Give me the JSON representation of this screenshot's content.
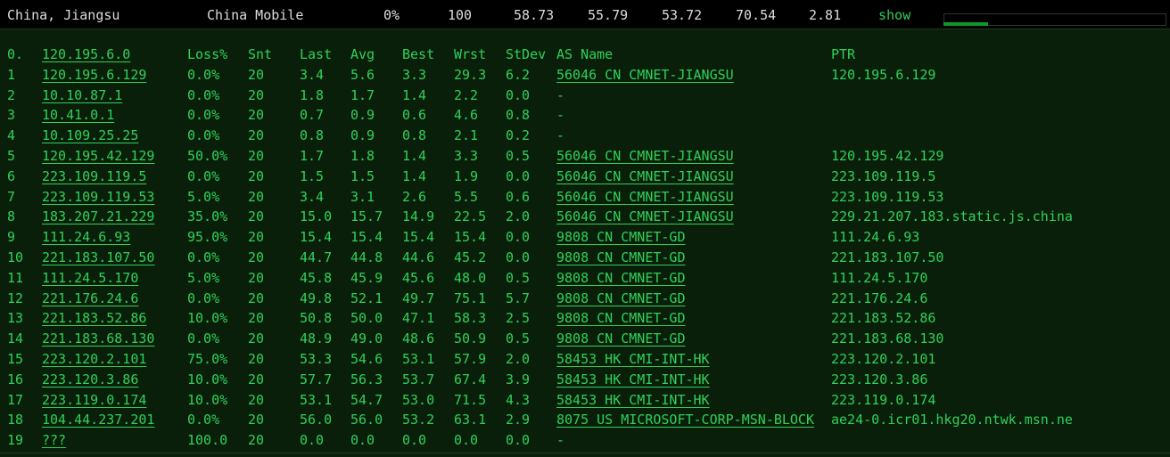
{
  "summary": {
    "location": "China, Jiangsu",
    "isp": "China Mobile",
    "loss": "0%",
    "sent": "100",
    "last": "58.73",
    "avg": "55.79",
    "best": "53.72",
    "worst": "70.54",
    "stdev": "2.81",
    "show_label": "show",
    "progress_fraction": 0.2
  },
  "header": {
    "no": "0.",
    "host": "120.195.6.0",
    "loss": "Loss%",
    "snt": "Snt",
    "last": "Last",
    "avg": "Avg",
    "best": "Best",
    "wrst": "Wrst",
    "stdev": "StDev",
    "as": "AS Name",
    "ptr": "PTR"
  },
  "hops": [
    {
      "no": "1",
      "host": "120.195.6.129",
      "loss": "0.0%",
      "snt": "20",
      "last": "3.4",
      "avg": "5.6",
      "best": "3.3",
      "wrst": "29.3",
      "stdev": "6.2",
      "as": "56046 CN CMNET-JIANGSU",
      "ptr": "120.195.6.129"
    },
    {
      "no": "2",
      "host": "10.10.87.1",
      "loss": "0.0%",
      "snt": "20",
      "last": "1.8",
      "avg": "1.7",
      "best": "1.4",
      "wrst": "2.2",
      "stdev": "0.0",
      "as": "-",
      "ptr": ""
    },
    {
      "no": "3",
      "host": "10.41.0.1",
      "loss": "0.0%",
      "snt": "20",
      "last": "0.7",
      "avg": "0.9",
      "best": "0.6",
      "wrst": "4.6",
      "stdev": "0.8",
      "as": "-",
      "ptr": ""
    },
    {
      "no": "4",
      "host": "10.109.25.25",
      "loss": "0.0%",
      "snt": "20",
      "last": "0.8",
      "avg": "0.9",
      "best": "0.8",
      "wrst": "2.1",
      "stdev": "0.2",
      "as": "-",
      "ptr": ""
    },
    {
      "no": "5",
      "host": "120.195.42.129",
      "loss": "50.0%",
      "snt": "20",
      "last": "1.7",
      "avg": "1.8",
      "best": "1.4",
      "wrst": "3.3",
      "stdev": "0.5",
      "as": "56046 CN CMNET-JIANGSU",
      "ptr": "120.195.42.129"
    },
    {
      "no": "6",
      "host": "223.109.119.5",
      "loss": "0.0%",
      "snt": "20",
      "last": "1.5",
      "avg": "1.5",
      "best": "1.4",
      "wrst": "1.9",
      "stdev": "0.0",
      "as": "56046 CN CMNET-JIANGSU",
      "ptr": "223.109.119.5"
    },
    {
      "no": "7",
      "host": "223.109.119.53",
      "loss": "5.0%",
      "snt": "20",
      "last": "3.4",
      "avg": "3.1",
      "best": "2.6",
      "wrst": "5.5",
      "stdev": "0.6",
      "as": "56046 CN CMNET-JIANGSU",
      "ptr": "223.109.119.53"
    },
    {
      "no": "8",
      "host": "183.207.21.229",
      "loss": "35.0%",
      "snt": "20",
      "last": "15.0",
      "avg": "15.7",
      "best": "14.9",
      "wrst": "22.5",
      "stdev": "2.0",
      "as": "56046 CN CMNET-JIANGSU",
      "ptr": "229.21.207.183.static.js.china"
    },
    {
      "no": "9",
      "host": "111.24.6.93",
      "loss": "95.0%",
      "snt": "20",
      "last": "15.4",
      "avg": "15.4",
      "best": "15.4",
      "wrst": "15.4",
      "stdev": "0.0",
      "as": "9808  CN CMNET-GD",
      "ptr": "111.24.6.93"
    },
    {
      "no": "10",
      "host": "221.183.107.50",
      "loss": "0.0%",
      "snt": "20",
      "last": "44.7",
      "avg": "44.8",
      "best": "44.6",
      "wrst": "45.2",
      "stdev": "0.0",
      "as": "9808  CN CMNET-GD",
      "ptr": "221.183.107.50"
    },
    {
      "no": "11",
      "host": "111.24.5.170",
      "loss": "5.0%",
      "snt": "20",
      "last": "45.8",
      "avg": "45.9",
      "best": "45.6",
      "wrst": "48.0",
      "stdev": "0.5",
      "as": "9808  CN CMNET-GD",
      "ptr": "111.24.5.170"
    },
    {
      "no": "12",
      "host": "221.176.24.6",
      "loss": "0.0%",
      "snt": "20",
      "last": "49.8",
      "avg": "52.1",
      "best": "49.7",
      "wrst": "75.1",
      "stdev": "5.7",
      "as": "9808  CN CMNET-GD",
      "ptr": "221.176.24.6"
    },
    {
      "no": "13",
      "host": "221.183.52.86",
      "loss": "10.0%",
      "snt": "20",
      "last": "50.8",
      "avg": "50.0",
      "best": "47.1",
      "wrst": "58.3",
      "stdev": "2.5",
      "as": "9808  CN CMNET-GD",
      "ptr": "221.183.52.86"
    },
    {
      "no": "14",
      "host": "221.183.68.130",
      "loss": "0.0%",
      "snt": "20",
      "last": "48.9",
      "avg": "49.0",
      "best": "48.6",
      "wrst": "50.9",
      "stdev": "0.5",
      "as": "9808  CN CMNET-GD",
      "ptr": "221.183.68.130"
    },
    {
      "no": "15",
      "host": "223.120.2.101",
      "loss": "75.0%",
      "snt": "20",
      "last": "53.3",
      "avg": "54.6",
      "best": "53.1",
      "wrst": "57.9",
      "stdev": "2.0",
      "as": "58453 HK CMI-INT-HK",
      "ptr": "223.120.2.101"
    },
    {
      "no": "16",
      "host": "223.120.3.86",
      "loss": "10.0%",
      "snt": "20",
      "last": "57.7",
      "avg": "56.3",
      "best": "53.7",
      "wrst": "67.4",
      "stdev": "3.9",
      "as": "58453 HK CMI-INT-HK",
      "ptr": "223.120.3.86"
    },
    {
      "no": "17",
      "host": "223.119.0.174",
      "loss": "10.0%",
      "snt": "20",
      "last": "53.1",
      "avg": "54.7",
      "best": "53.0",
      "wrst": "71.5",
      "stdev": "4.3",
      "as": "58453 HK CMI-INT-HK",
      "ptr": "223.119.0.174"
    },
    {
      "no": "18",
      "host": "104.44.237.201",
      "loss": "0.0%",
      "snt": "20",
      "last": "56.0",
      "avg": "56.0",
      "best": "53.2",
      "wrst": "63.1",
      "stdev": "2.9",
      "as": "8075  US MICROSOFT-CORP-MSN-BLOCK",
      "ptr": "ae24-0.icr01.hkg20.ntwk.msn.ne"
    },
    {
      "no": "19",
      "host": "???",
      "loss": "100.0",
      "snt": "20",
      "last": "0.0",
      "avg": "0.0",
      "best": "0.0",
      "wrst": "0.0",
      "stdev": "0.0",
      "as": "-",
      "ptr": ""
    }
  ],
  "colors": {
    "background": "#0a1f0a",
    "text_green": "#2fd15a",
    "topbar_bg": "#000000",
    "topbar_text": "#dcdcdc",
    "progress_fill": "#0c9a2a"
  }
}
